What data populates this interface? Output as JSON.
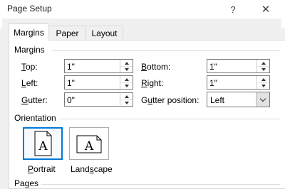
{
  "window": {
    "title": "Page Setup",
    "help_glyph": "?",
    "close_glyph": "✕"
  },
  "tabs": [
    {
      "label": "Margins",
      "active": true
    },
    {
      "label": "Paper",
      "active": false
    },
    {
      "label": "Layout",
      "active": false
    }
  ],
  "margins": {
    "heading": "Margins",
    "top": {
      "label_key": "T",
      "label_rest": "op:",
      "value": "1\""
    },
    "left": {
      "label_key": "L",
      "label_rest": "eft:",
      "value": "1\""
    },
    "gutter": {
      "label_key": "G",
      "label_rest": "utter:",
      "value": "0\""
    },
    "bottom": {
      "label_key": "B",
      "label_rest": "ottom:",
      "value": "1\""
    },
    "right": {
      "label_key": "R",
      "label_rest": "ight:",
      "value": "1\""
    },
    "gutter_position": {
      "label_pre": "G",
      "label_key": "u",
      "label_rest": "tter position:",
      "value": "Left"
    }
  },
  "orientation": {
    "heading": "Orientation",
    "glyph": "A",
    "portrait": {
      "label_key": "P",
      "label_rest": "ortrait",
      "selected": true
    },
    "landscape": {
      "label_pre": "Land",
      "label_key": "s",
      "label_rest": "cape",
      "selected": false
    }
  },
  "pages": {
    "heading": "Pages"
  },
  "colors": {
    "accent": "#0078d7",
    "panel": "#ffffff",
    "dialog": "#f0f0f0"
  }
}
